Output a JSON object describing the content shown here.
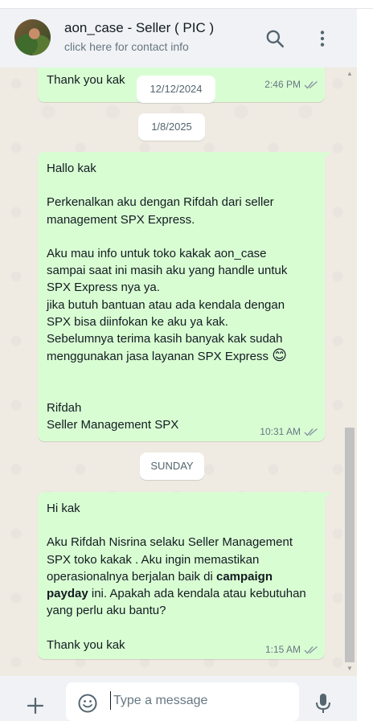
{
  "header": {
    "contact_name": "aon_case - Seller ( PIC )",
    "contact_subtitle": "click here for contact info",
    "search_icon": "search-icon",
    "menu_icon": "kebab-menu-icon"
  },
  "messages": [
    {
      "lines": [
        "Thank you kak"
      ],
      "time": "2:46 PM",
      "status": "read"
    },
    {
      "lines": [
        "Hallo kak",
        "",
        "Perkenalkan aku dengan Rifdah dari seller",
        "management SPX Express.",
        "",
        "Aku mau info untuk toko kakak aon_case",
        "sampai saat ini masih aku yang handle untuk",
        "SPX Express nya ya.",
        "jika butuh bantuan atau ada kendala dengan",
        "SPX bisa diinfokan ke aku ya kak.",
        "Sebelumnya terima kasih banyak kak sudah",
        "menggunakan jasa layanan SPX Express",
        "",
        "",
        "Rifdah",
        "Seller Management SPX"
      ],
      "emoji": "😊",
      "time": "10:31 AM",
      "status": "read"
    },
    {
      "line1": "Hi kak",
      "line2": "Aku Rifdah Nisrina selaku Seller Management",
      "line3": "SPX toko kakak . Aku ingin memastikan",
      "line4_pre": "operasionalnya berjalan baik di ",
      "line4_bold": "campaign",
      "line5_bold": "payday",
      "line5_post": " ini. Apakah ada kendala atau kebutuhan",
      "line6": "yang perlu aku bantu?",
      "line7": "Thank you kak",
      "time": "1:15 AM",
      "status": "read"
    }
  ],
  "date_separators": [
    "12/12/2024",
    "1/8/2025",
    "SUNDAY"
  ],
  "composer": {
    "placeholder": "Type a message",
    "attach_icon": "plus-icon",
    "emoji_icon": "emoji-icon",
    "mic_icon": "microphone-icon"
  },
  "colors": {
    "outgoing_bubble": "#d9fdd3",
    "chat_background": "#efeae2",
    "header_background": "#f0f2f5",
    "read_ticks": "#8696a0"
  }
}
